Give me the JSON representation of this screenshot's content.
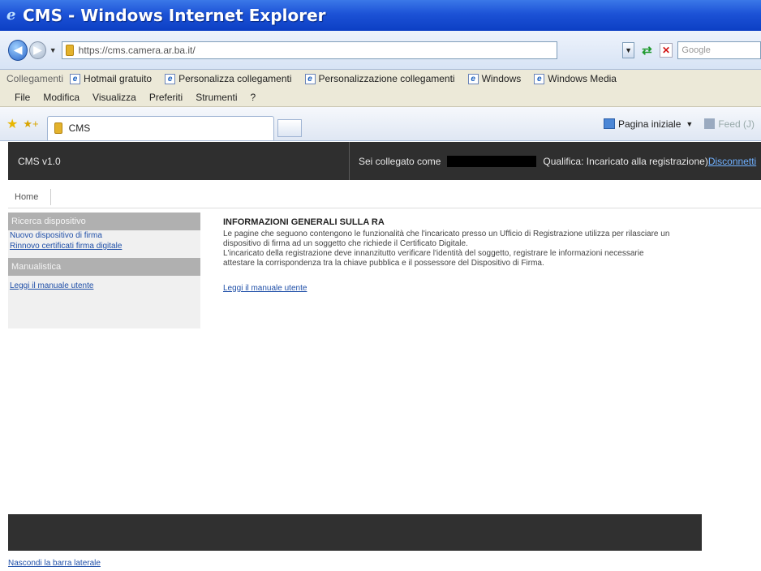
{
  "window": {
    "title": "CMS - Windows Internet Explorer"
  },
  "address": {
    "url": "https://cms.camera.ar.ba.it/",
    "search_placeholder": "Google"
  },
  "links_bar": {
    "label": "Collegamenti",
    "items": [
      "Hotmail gratuito",
      "Personalizza collegamenti",
      "Personalizzazione collegamenti",
      "Windows",
      "Windows Media"
    ]
  },
  "menu": {
    "items": [
      "File",
      "Modifica",
      "Visualizza",
      "Preferiti",
      "Strumenti",
      "?"
    ]
  },
  "tabs": {
    "active_label": "CMS"
  },
  "command_bar": {
    "home_label": "Pagina iniziale",
    "feeds_label": "Feed (J)"
  },
  "app": {
    "name": "CMS v1.0",
    "login_prefix": "Sei collegato come",
    "qualifier": "Qualifica: Incaricato alla registrazione)",
    "logout": "Disconnetti"
  },
  "breadcrumb": {
    "home": "Home"
  },
  "sidebar": {
    "section1": "Ricerca dispositivo",
    "links1": [
      "Nuovo dispositivo di firma",
      "Rinnovo certificati firma digitale"
    ],
    "section2": "Manualistica",
    "links2": [
      "Leggi il manuale utente"
    ]
  },
  "content": {
    "title": "INFORMAZIONI GENERALI SULLA RA",
    "para1": "Le pagine che seguono contengono le funzionalità che l'incaricato presso un Ufficio di Registrazione utilizza per rilasciare un",
    "para2": "dispositivo di firma ad un soggetto che richiede il Certificato Digitale.",
    "para3": "L'incaricato della registrazione deve innanzitutto verificare l'identità del soggetto, registrare le informazioni necessarie",
    "para4": "attestare la corrispondenza tra la chiave pubblica e il possessore del Dispositivo di Firma.",
    "manual_link": "Leggi il manuale utente"
  },
  "footer": {
    "hide_sidebar": "Nascondi la barra laterale"
  }
}
